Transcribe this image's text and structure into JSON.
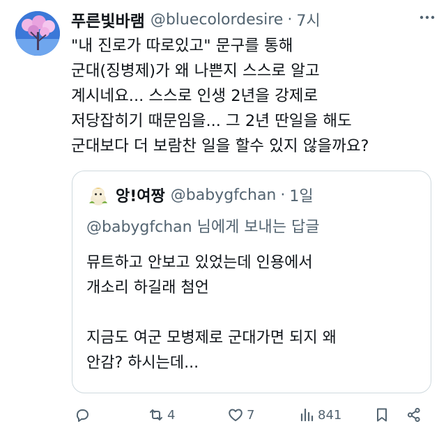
{
  "tweet": {
    "display_name": "푸른빛바램",
    "handle": "@bluecolordesire",
    "separator": "·",
    "time": "7시",
    "lines": [
      "\"내 진로가 따로있고\" 문구를 통해",
      "군대(징병제)가 왜 나쁜지 스스로 알고",
      "계시네요... 스스로 인생 2년을 강제로",
      "저당잡히기 때문임을... 그 2년 딴일을 해도",
      "군대보다 더 보람찬 일을 할수 있지 않을까요?"
    ]
  },
  "quote": {
    "display_name": "앙!여짱",
    "handle": "@babygfchan",
    "separator": "·",
    "time": "1일",
    "reply_line": "@babygfchan 님에게 보내는 답글",
    "lines": [
      "뮤트하고 안보고 있었는데 인용에서",
      "개소리 하길래 첨언",
      "",
      "지금도 여군 모병제로 군대가면 되지 왜",
      "안감? 하시는데..."
    ]
  },
  "actions": {
    "reply_icon": "reply-icon",
    "retweet_icon": "retweet-icon",
    "retweet_count": "4",
    "like_icon": "heart-icon",
    "like_count": "7",
    "views_icon": "views-icon",
    "views_count": "841",
    "bookmark_icon": "bookmark-icon",
    "share_icon": "share-icon"
  },
  "colors": {
    "text": "#0f1419",
    "secondary": "#536471",
    "border": "#cfd9de"
  }
}
